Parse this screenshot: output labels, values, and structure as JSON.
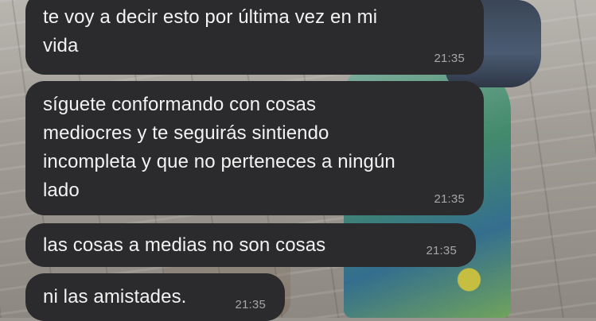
{
  "messages": [
    {
      "text": "te voy a decir esto por última vez en mi\nvida",
      "time": "21:35"
    },
    {
      "text": "síguete conformando con cosas\nmediocres y te seguirás sintiendo\nincompleta y que no perteneces a ningún\nlado",
      "time": "21:35"
    },
    {
      "text": "las cosas a medias no son cosas",
      "time": "21:35"
    },
    {
      "text": "ni las amistades.",
      "time": "21:35"
    }
  ],
  "colors": {
    "bubble_bg": "#2b2b2d",
    "bubble_text": "#f2f2f2",
    "timestamp": "#a6a6aa"
  }
}
